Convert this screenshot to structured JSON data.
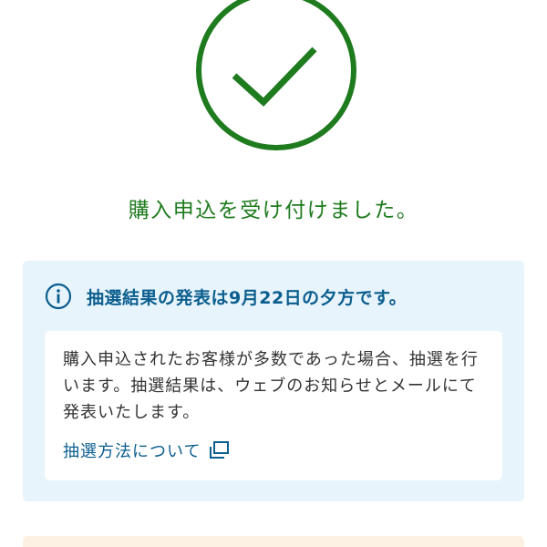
{
  "status": {
    "icon": "check-circle-icon",
    "message": "購入申込を受け付けました。",
    "accent_color": "#1e7b1e"
  },
  "lottery_notice": {
    "icon": "info-icon",
    "title": "抽選結果の発表は9月22日の夕方です。",
    "body": "購入申込されたお客様が多数であった場合、抽選を行います。抽選結果は、ウェブのお知らせとメールにて発表いたします。",
    "link_label": "抽選方法について",
    "link_icon": "external-window-icon",
    "accent_color": "#0b5e8e",
    "background_color": "#e8f4fb"
  },
  "next_section": {
    "background_color": "#fdf1e4"
  }
}
